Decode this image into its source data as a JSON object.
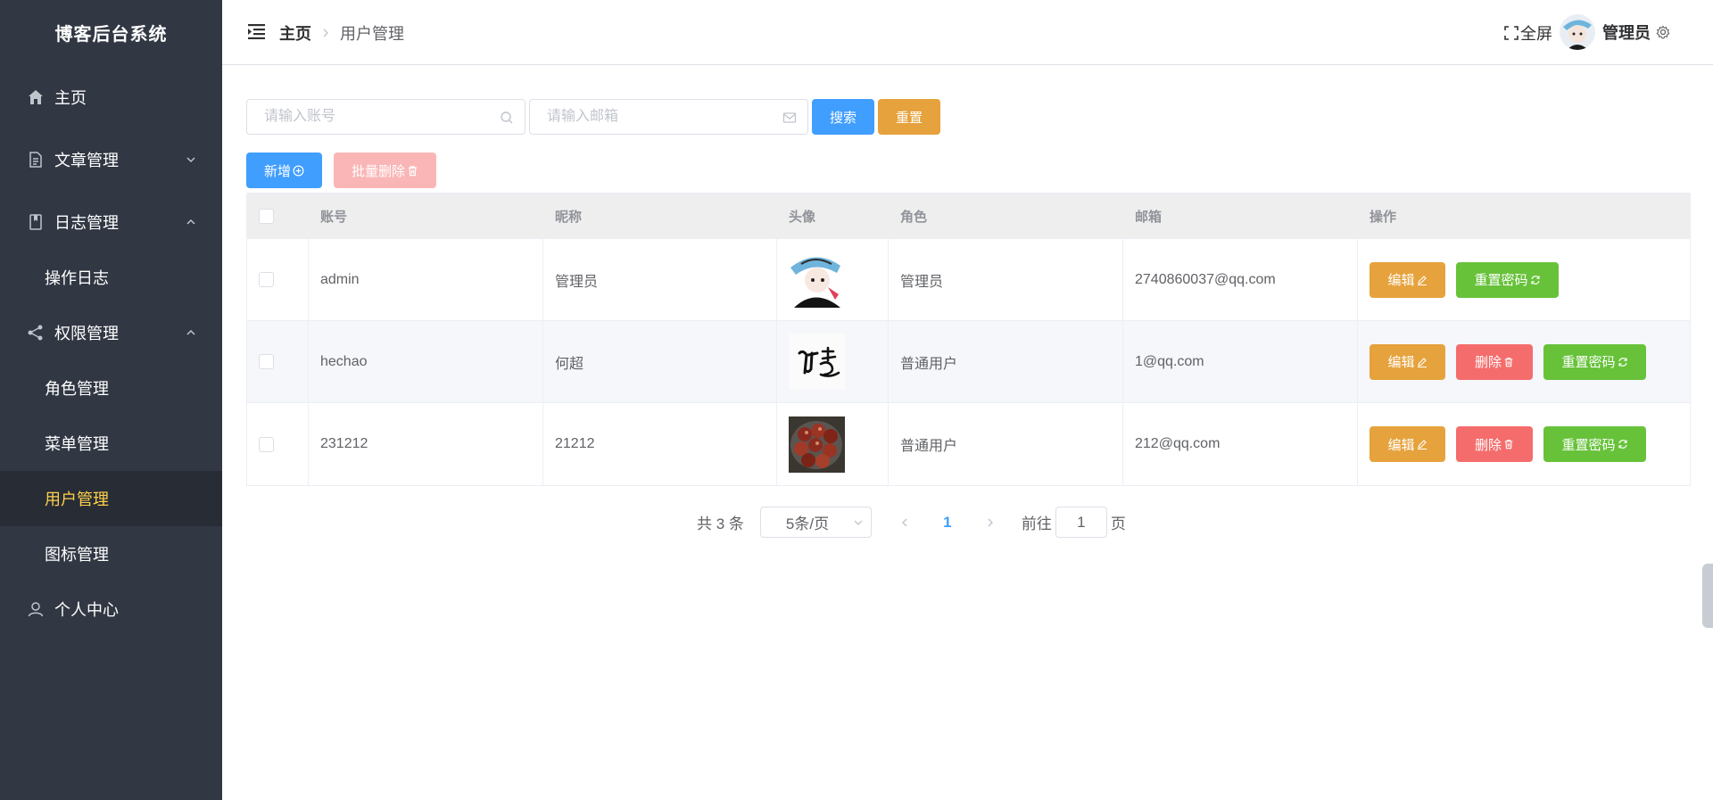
{
  "sidebar": {
    "title": "博客后台系统",
    "home": "主页",
    "article": "文章管理",
    "log": "日志管理",
    "log_children": [
      "操作日志"
    ],
    "auth": "权限管理",
    "auth_children": [
      "角色管理",
      "菜单管理",
      "用户管理",
      "图标管理"
    ],
    "profile": "个人中心",
    "active_color": "#ffd04b"
  },
  "header": {
    "crumb_home": "主页",
    "crumb_current": "用户管理",
    "fullscreen": "全屏",
    "user_name": "管理员"
  },
  "search": {
    "account_placeholder": "请输入账号",
    "email_placeholder": "请输入邮箱",
    "search_label": "搜索",
    "reset_label": "重置"
  },
  "actions": {
    "add_label": "新增",
    "batch_delete_label": "批量删除"
  },
  "table": {
    "columns": [
      "账号",
      "昵称",
      "头像",
      "角色",
      "邮箱",
      "操作"
    ],
    "rows": [
      {
        "account": "admin",
        "nickname": "管理员",
        "role": "管理员",
        "email": "2740860037@qq.com",
        "avatar": "anime-avatar"
      },
      {
        "account": "hechao",
        "nickname": "何超",
        "role": "普通用户",
        "email": "1@qq.com",
        "avatar": "calligraphy-avatar"
      },
      {
        "account": "231212",
        "nickname": "21212",
        "role": "普通用户",
        "email": "212@qq.com",
        "avatar": "food-avatar"
      }
    ],
    "edit_label": "编辑",
    "delete_label": "删除",
    "reset_pwd_label": "重置密码"
  },
  "pagination": {
    "total": "共 3 条",
    "page_size": "5条/页",
    "current": "1",
    "goto": "前往",
    "goto_value": "1",
    "page_unit": "页"
  },
  "colors": {
    "sidebar_bg": "#313743",
    "primary": "#409eff",
    "warning": "#e6a23c",
    "danger": "#f56c6c",
    "success": "#67c23a"
  }
}
